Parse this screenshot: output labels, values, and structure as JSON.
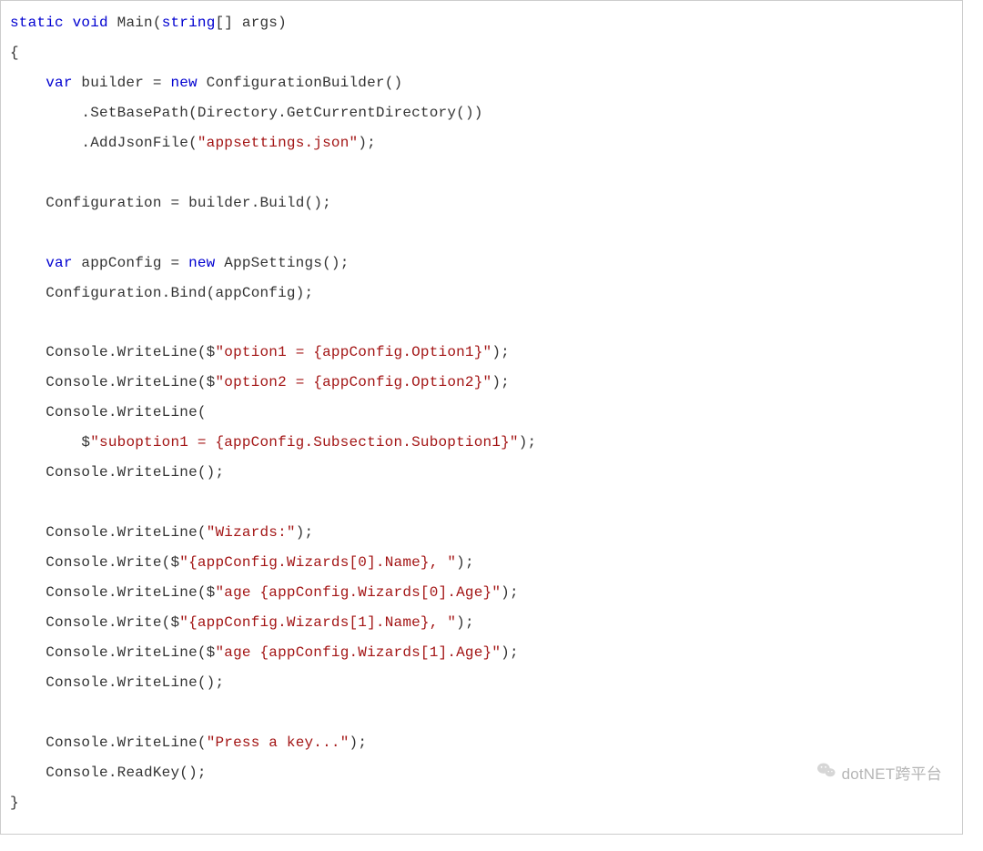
{
  "code": {
    "lines": [
      {
        "indent": 0,
        "tokens": [
          {
            "t": "kw",
            "v": "static"
          },
          {
            "t": "pln",
            "v": " "
          },
          {
            "t": "kw",
            "v": "void"
          },
          {
            "t": "pln",
            "v": " "
          },
          {
            "t": "typ",
            "v": "Main"
          },
          {
            "t": "pun",
            "v": "("
          },
          {
            "t": "kw",
            "v": "string"
          },
          {
            "t": "pun",
            "v": "[] "
          },
          {
            "t": "pln",
            "v": "args"
          },
          {
            "t": "pun",
            "v": ")"
          }
        ]
      },
      {
        "indent": 0,
        "tokens": [
          {
            "t": "pun",
            "v": "{"
          }
        ]
      },
      {
        "indent": 1,
        "tokens": [
          {
            "t": "kw",
            "v": "var"
          },
          {
            "t": "pln",
            "v": " builder "
          },
          {
            "t": "pun",
            "v": "= "
          },
          {
            "t": "kw",
            "v": "new"
          },
          {
            "t": "pln",
            "v": " ConfigurationBuilder"
          },
          {
            "t": "pun",
            "v": "()"
          }
        ]
      },
      {
        "indent": 2,
        "tokens": [
          {
            "t": "pun",
            "v": "."
          },
          {
            "t": "pln",
            "v": "SetBasePath"
          },
          {
            "t": "pun",
            "v": "("
          },
          {
            "t": "pln",
            "v": "Directory"
          },
          {
            "t": "pun",
            "v": "."
          },
          {
            "t": "pln",
            "v": "GetCurrentDirectory"
          },
          {
            "t": "pun",
            "v": "())"
          }
        ]
      },
      {
        "indent": 2,
        "tokens": [
          {
            "t": "pun",
            "v": "."
          },
          {
            "t": "pln",
            "v": "AddJsonFile"
          },
          {
            "t": "pun",
            "v": "("
          },
          {
            "t": "str",
            "v": "\"appsettings.json\""
          },
          {
            "t": "pun",
            "v": ");"
          }
        ]
      },
      {
        "indent": 0,
        "tokens": []
      },
      {
        "indent": 1,
        "tokens": [
          {
            "t": "pln",
            "v": "Configuration "
          },
          {
            "t": "pun",
            "v": "= "
          },
          {
            "t": "pln",
            "v": "builder"
          },
          {
            "t": "pun",
            "v": "."
          },
          {
            "t": "pln",
            "v": "Build"
          },
          {
            "t": "pun",
            "v": "();"
          }
        ]
      },
      {
        "indent": 0,
        "tokens": []
      },
      {
        "indent": 1,
        "tokens": [
          {
            "t": "kw",
            "v": "var"
          },
          {
            "t": "pln",
            "v": " appConfig "
          },
          {
            "t": "pun",
            "v": "= "
          },
          {
            "t": "kw",
            "v": "new"
          },
          {
            "t": "pln",
            "v": " AppSettings"
          },
          {
            "t": "pun",
            "v": "();"
          }
        ]
      },
      {
        "indent": 1,
        "tokens": [
          {
            "t": "pln",
            "v": "Configuration"
          },
          {
            "t": "pun",
            "v": "."
          },
          {
            "t": "pln",
            "v": "Bind"
          },
          {
            "t": "pun",
            "v": "("
          },
          {
            "t": "pln",
            "v": "appConfig"
          },
          {
            "t": "pun",
            "v": ");"
          }
        ]
      },
      {
        "indent": 0,
        "tokens": []
      },
      {
        "indent": 1,
        "tokens": [
          {
            "t": "pln",
            "v": "Console"
          },
          {
            "t": "pun",
            "v": "."
          },
          {
            "t": "pln",
            "v": "WriteLine"
          },
          {
            "t": "pun",
            "v": "($"
          },
          {
            "t": "str",
            "v": "\"option1 = {appConfig.Option1}\""
          },
          {
            "t": "pun",
            "v": ");"
          }
        ]
      },
      {
        "indent": 1,
        "tokens": [
          {
            "t": "pln",
            "v": "Console"
          },
          {
            "t": "pun",
            "v": "."
          },
          {
            "t": "pln",
            "v": "WriteLine"
          },
          {
            "t": "pun",
            "v": "($"
          },
          {
            "t": "str",
            "v": "\"option2 = {appConfig.Option2}\""
          },
          {
            "t": "pun",
            "v": ");"
          }
        ]
      },
      {
        "indent": 1,
        "tokens": [
          {
            "t": "pln",
            "v": "Console"
          },
          {
            "t": "pun",
            "v": "."
          },
          {
            "t": "pln",
            "v": "WriteLine"
          },
          {
            "t": "pun",
            "v": "("
          }
        ]
      },
      {
        "indent": 2,
        "tokens": [
          {
            "t": "pun",
            "v": "$"
          },
          {
            "t": "str",
            "v": "\"suboption1 = {appConfig.Subsection.Suboption1}\""
          },
          {
            "t": "pun",
            "v": ");"
          }
        ]
      },
      {
        "indent": 1,
        "tokens": [
          {
            "t": "pln",
            "v": "Console"
          },
          {
            "t": "pun",
            "v": "."
          },
          {
            "t": "pln",
            "v": "WriteLine"
          },
          {
            "t": "pun",
            "v": "();"
          }
        ]
      },
      {
        "indent": 0,
        "tokens": []
      },
      {
        "indent": 1,
        "tokens": [
          {
            "t": "pln",
            "v": "Console"
          },
          {
            "t": "pun",
            "v": "."
          },
          {
            "t": "pln",
            "v": "WriteLine"
          },
          {
            "t": "pun",
            "v": "("
          },
          {
            "t": "str",
            "v": "\"Wizards:\""
          },
          {
            "t": "pun",
            "v": ");"
          }
        ]
      },
      {
        "indent": 1,
        "tokens": [
          {
            "t": "pln",
            "v": "Console"
          },
          {
            "t": "pun",
            "v": "."
          },
          {
            "t": "pln",
            "v": "Write"
          },
          {
            "t": "pun",
            "v": "($"
          },
          {
            "t": "str",
            "v": "\"{appConfig.Wizards[0].Name}, \""
          },
          {
            "t": "pun",
            "v": ");"
          }
        ]
      },
      {
        "indent": 1,
        "tokens": [
          {
            "t": "pln",
            "v": "Console"
          },
          {
            "t": "pun",
            "v": "."
          },
          {
            "t": "pln",
            "v": "WriteLine"
          },
          {
            "t": "pun",
            "v": "($"
          },
          {
            "t": "str",
            "v": "\"age {appConfig.Wizards[0].Age}\""
          },
          {
            "t": "pun",
            "v": ");"
          }
        ]
      },
      {
        "indent": 1,
        "tokens": [
          {
            "t": "pln",
            "v": "Console"
          },
          {
            "t": "pun",
            "v": "."
          },
          {
            "t": "pln",
            "v": "Write"
          },
          {
            "t": "pun",
            "v": "($"
          },
          {
            "t": "str",
            "v": "\"{appConfig.Wizards[1].Name}, \""
          },
          {
            "t": "pun",
            "v": ");"
          }
        ]
      },
      {
        "indent": 1,
        "tokens": [
          {
            "t": "pln",
            "v": "Console"
          },
          {
            "t": "pun",
            "v": "."
          },
          {
            "t": "pln",
            "v": "WriteLine"
          },
          {
            "t": "pun",
            "v": "($"
          },
          {
            "t": "str",
            "v": "\"age {appConfig.Wizards[1].Age}\""
          },
          {
            "t": "pun",
            "v": ");"
          }
        ]
      },
      {
        "indent": 1,
        "tokens": [
          {
            "t": "pln",
            "v": "Console"
          },
          {
            "t": "pun",
            "v": "."
          },
          {
            "t": "pln",
            "v": "WriteLine"
          },
          {
            "t": "pun",
            "v": "();"
          }
        ]
      },
      {
        "indent": 0,
        "tokens": []
      },
      {
        "indent": 1,
        "tokens": [
          {
            "t": "pln",
            "v": "Console"
          },
          {
            "t": "pun",
            "v": "."
          },
          {
            "t": "pln",
            "v": "WriteLine"
          },
          {
            "t": "pun",
            "v": "("
          },
          {
            "t": "str",
            "v": "\"Press a key...\""
          },
          {
            "t": "pun",
            "v": ");"
          }
        ]
      },
      {
        "indent": 1,
        "tokens": [
          {
            "t": "pln",
            "v": "Console"
          },
          {
            "t": "pun",
            "v": "."
          },
          {
            "t": "pln",
            "v": "ReadKey"
          },
          {
            "t": "pun",
            "v": "();"
          }
        ]
      },
      {
        "indent": 0,
        "tokens": [
          {
            "t": "pun",
            "v": "}"
          }
        ]
      }
    ]
  },
  "watermark": {
    "text": "dotNET跨平台"
  }
}
